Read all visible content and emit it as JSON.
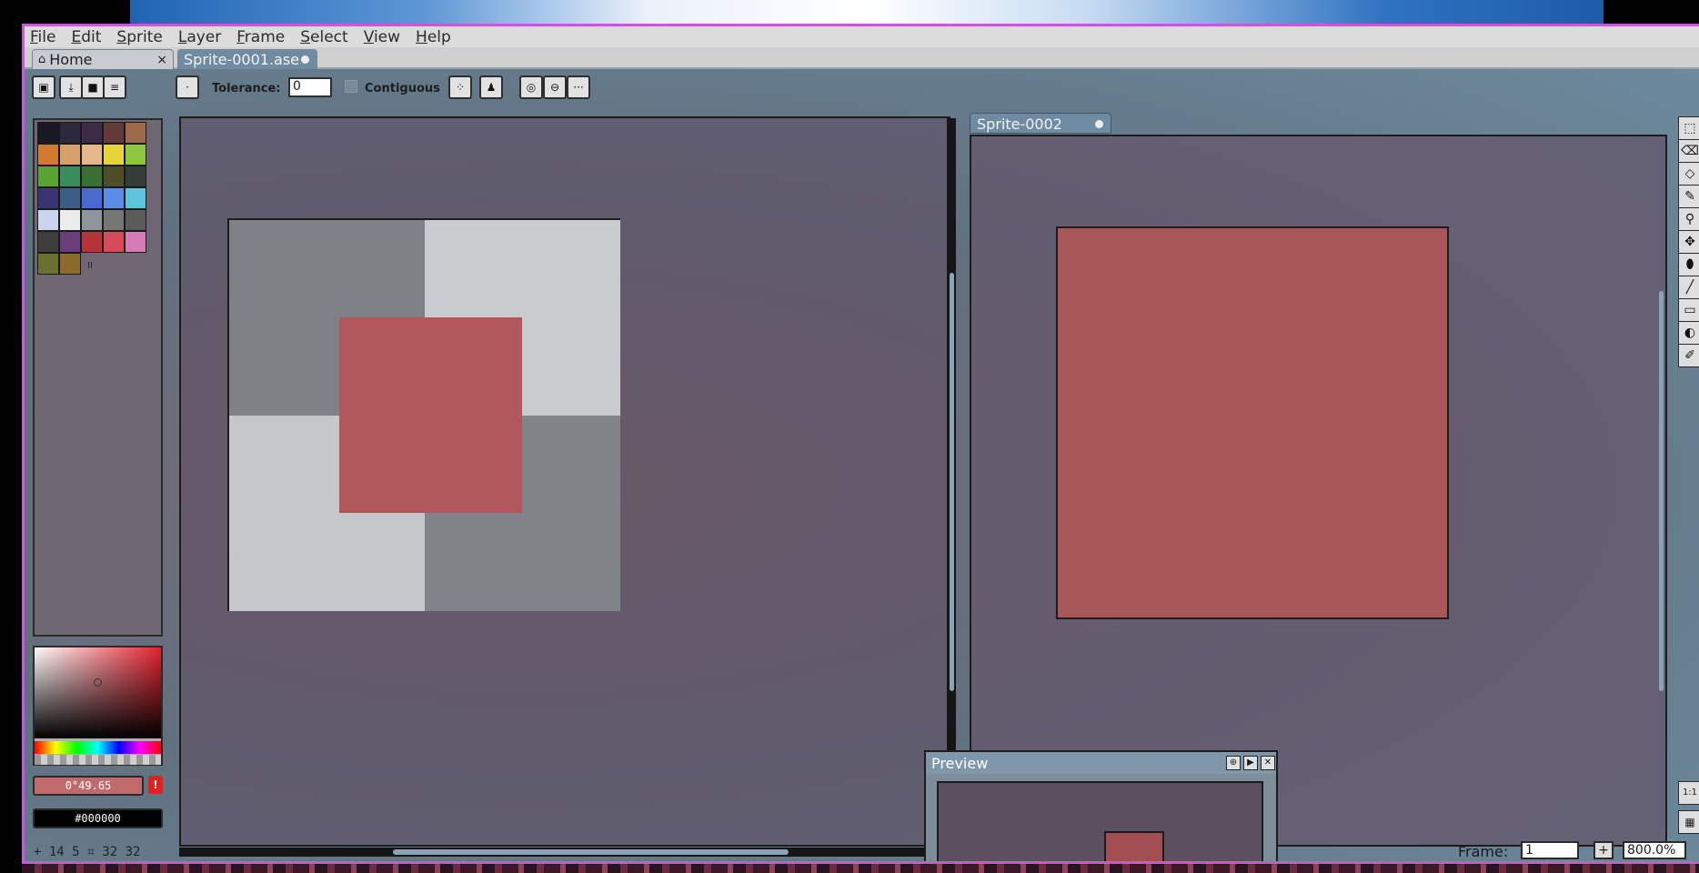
{
  "menu": [
    "File",
    "Edit",
    "Sprite",
    "Layer",
    "Frame",
    "Select",
    "View",
    "Help"
  ],
  "tabs": {
    "home": {
      "label": "Home",
      "close": "×"
    },
    "sprite": {
      "label": "Sprite-0001.ase"
    }
  },
  "toolbar": {
    "tolerance_label": "Tolerance:",
    "tolerance_value": "0",
    "contiguous_label": "Contiguous",
    "pixel_btn": "·",
    "more_btn": "···"
  },
  "palette": {
    "colors": [
      "#1a1824",
      "#2b2840",
      "#3c2b46",
      "#623a36",
      "#9c6a4a",
      "#d37a2e",
      "#d5a06a",
      "#e6b78a",
      "#e6d43a",
      "#8cc63e",
      "#5aa332",
      "#3a8c5a",
      "#3b6e32",
      "#4c4e28",
      "#343c3a",
      "#3a3572",
      "#3b5d86",
      "#4a6ad2",
      "#5b8ce6",
      "#5dc4dc",
      "#c9d4ef",
      "#ececec",
      "#8e969c",
      "#767676",
      "#5a5a5a",
      "#3e3e3e",
      "#6a3c7a",
      "#b8323a",
      "#d54b5a",
      "#d67ab8",
      "#6a7030",
      "#8c6a2a"
    ],
    "handle": "II"
  },
  "color": {
    "hsv": "0°49.65",
    "warning": "!",
    "hex": "#000000"
  },
  "editor2": {
    "tab_label": "Sprite-0002"
  },
  "tools": [
    "⬚",
    "⌫",
    "◇",
    "✎",
    "⚲",
    "✥",
    "⬮",
    "╱",
    "▭",
    "◐",
    "✐"
  ],
  "preview": {
    "title": "Preview"
  },
  "status": {
    "position": "+ 14 5",
    "size": "32 32",
    "frame_label": "Frame:",
    "frame_value": "1",
    "plus": "+",
    "zoom": "800.0%",
    "ratio": "1:1"
  }
}
